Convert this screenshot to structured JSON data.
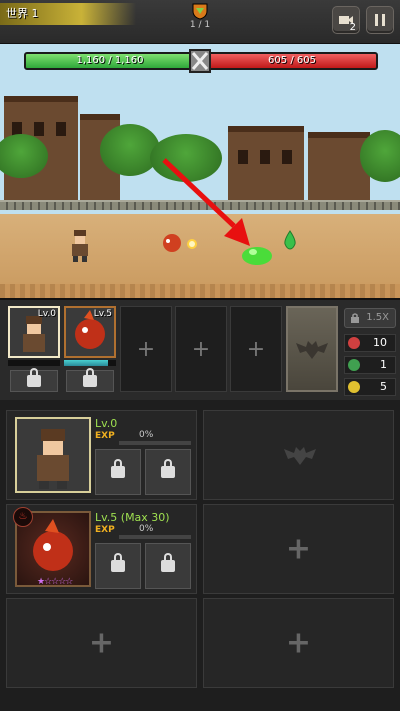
{
  "topbar": {
    "world_label": "世界 1",
    "wave_count": "1 / 1",
    "video_badge": "2"
  },
  "battle": {
    "player_hp": "1,160 / 1,160",
    "player_hp_fraction": 1.0,
    "enemy_hp": "605 / 605",
    "enemy_hp_fraction": 1.0
  },
  "party": {
    "slots": [
      {
        "level": "Lv.0",
        "hp_fraction": 0.0
      },
      {
        "level": "Lv.5",
        "hp_fraction": 0.85
      }
    ],
    "speed_label": "1.5X",
    "resources": [
      {
        "icon": "red-potion-icon",
        "value": "10",
        "color": "#d04040"
      },
      {
        "icon": "green-potion-icon",
        "value": "1",
        "color": "#40a050"
      },
      {
        "icon": "gold-egg-icon",
        "value": "5",
        "color": "#e0c030"
      }
    ]
  },
  "heroes": [
    {
      "level": "Lv.0",
      "exp_label": "EXP",
      "exp_pct": "0%"
    },
    {
      "level": "Lv.5 (Max 30)",
      "exp_label": "EXP",
      "exp_pct": "0%"
    }
  ],
  "colors": {
    "accent_gold": "#c9b238",
    "hp_green": "#2fa83a",
    "hp_red": "#c01a1a",
    "level_green": "#9fe050",
    "exp_orange": "#f0b020"
  }
}
